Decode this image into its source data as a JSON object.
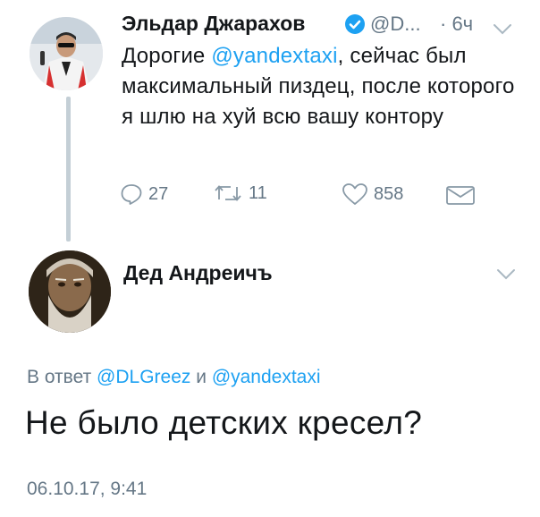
{
  "tweet": {
    "author_name": "Эльдар Джарахов",
    "author_handle": "@D...",
    "time_ago": "· 6ч",
    "text_before": "Дорогие ",
    "mention": "@yandextaxi",
    "text_after": ", сейчас был максимальный пиздец, после которого я шлю на хуй всю вашу контору",
    "reply_count": "27",
    "retweet_count": "11",
    "like_count": "858",
    "avatar_icon": "user-avatar",
    "verified_icon": "verified-badge-icon"
  },
  "reply": {
    "author_name": "Дед Андреичъ",
    "reply_prefix": "В ответ ",
    "reply_mention_1": "@DLGreez",
    "reply_joiner": " и ",
    "reply_mention_2": "@yandextaxi",
    "text": "Не было детских кресел?",
    "timestamp": "06.10.17, 9:41",
    "avatar_icon": "user-avatar"
  },
  "colors": {
    "accent": "#1da1f2",
    "secondary_text": "#657786",
    "primary_text": "#14171a",
    "thread_line": "#c4cfd6"
  }
}
